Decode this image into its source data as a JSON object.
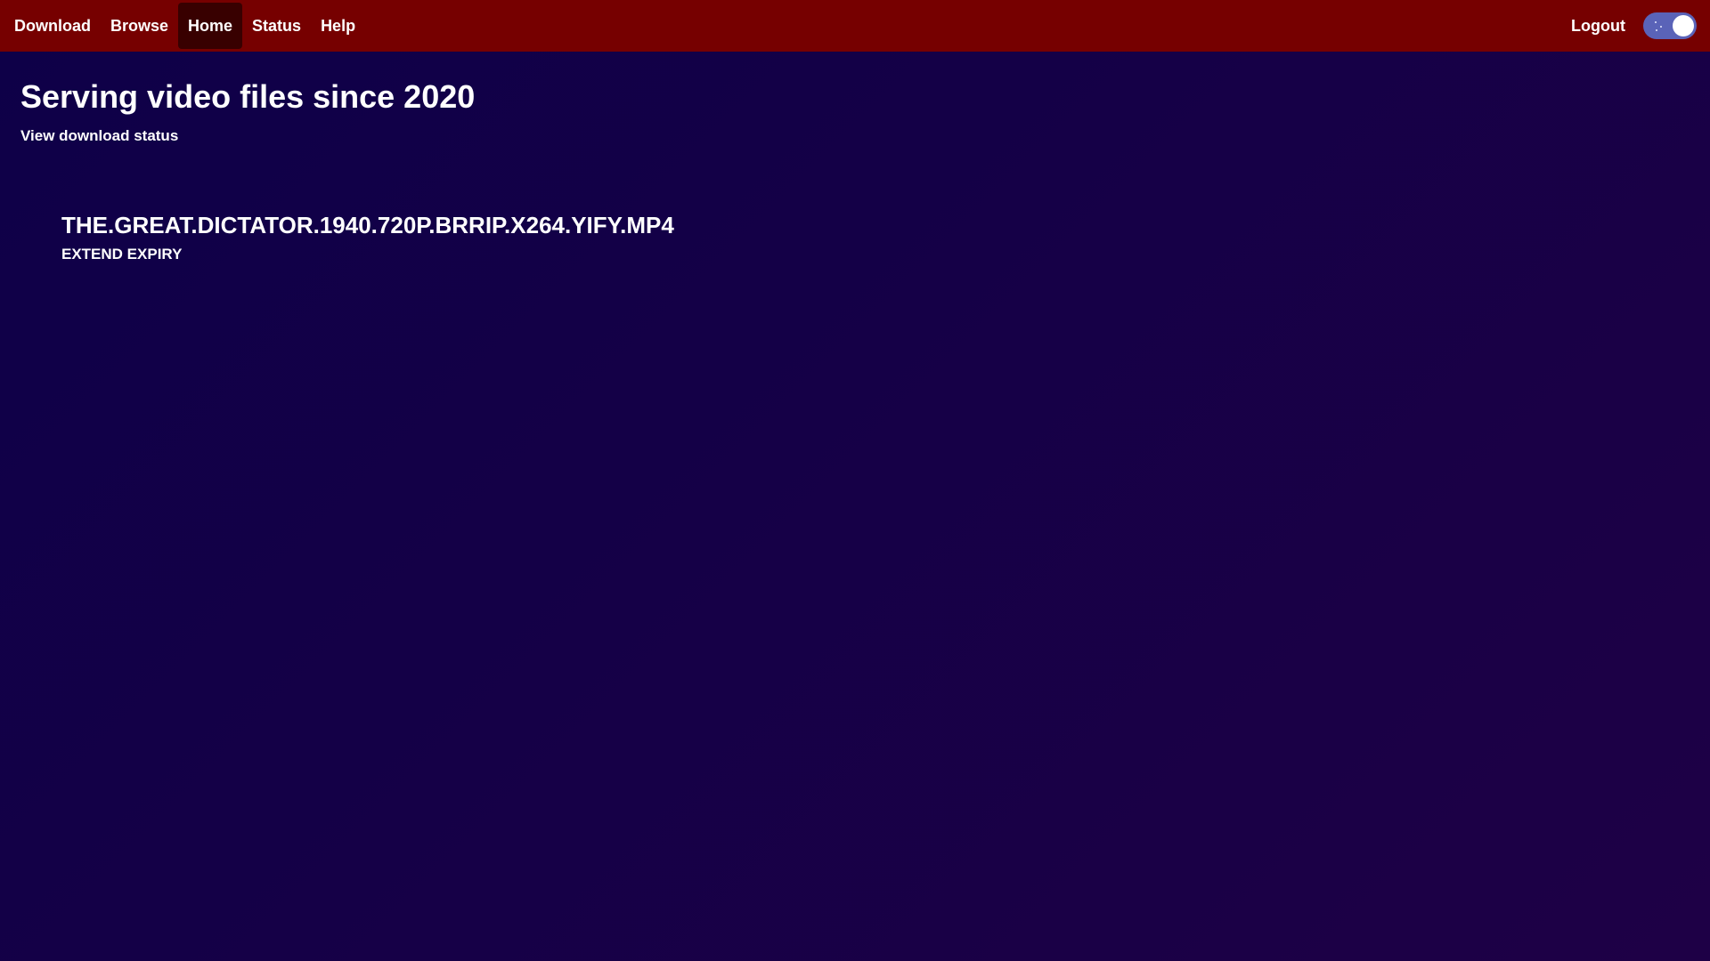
{
  "nav": {
    "items": [
      {
        "label": "Download",
        "active": false
      },
      {
        "label": "Browse",
        "active": false
      },
      {
        "label": "Home",
        "active": true
      },
      {
        "label": "Status",
        "active": false
      },
      {
        "label": "Help",
        "active": false
      }
    ],
    "logout_label": "Logout",
    "theme_toggle": {
      "state": "on",
      "icon": "moon-stars-icon"
    }
  },
  "main": {
    "title": "Serving video files since 2020",
    "status_link": "View download status"
  },
  "files": [
    {
      "name": "THE.GREAT.DICTATOR.1940.720P.BRRIP.X264.YIFY.MP4",
      "action_label": "EXTEND EXPIRY"
    }
  ],
  "colors": {
    "navbar": "#760000",
    "nav_active": "#380000",
    "background_start": "#0e0048",
    "background_end": "#1e0046",
    "toggle_track": "#5a63b8",
    "text": "#ffffff"
  }
}
